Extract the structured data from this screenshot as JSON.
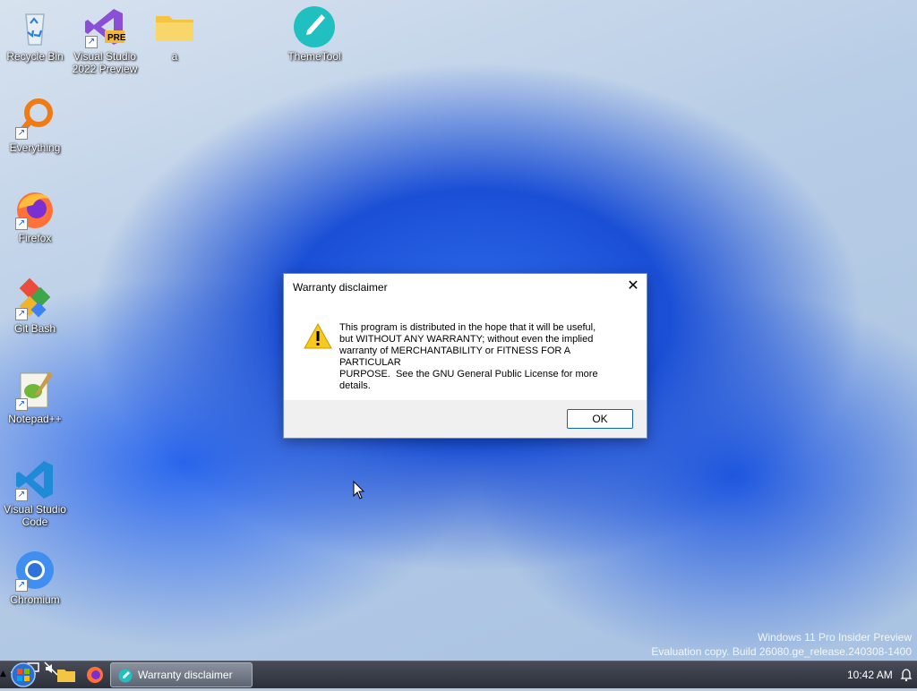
{
  "desktop": {
    "icons": [
      {
        "label": "Recycle Bin"
      },
      {
        "label": "Visual Studio 2022 Preview",
        "badge": "PRE"
      },
      {
        "label": "a"
      },
      {
        "label": "ThemeTool"
      },
      {
        "label": "Everything"
      },
      {
        "label": "Firefox"
      },
      {
        "label": "Git Bash"
      },
      {
        "label": "Notepad++"
      },
      {
        "label": "Visual Studio Code"
      },
      {
        "label": "Chromium"
      }
    ],
    "watermark": {
      "line1": "Windows 11 Pro Insider Preview",
      "line2": "Evaluation copy. Build 26080.ge_release.240308-1400"
    }
  },
  "dialog": {
    "title": "Warranty disclaimer",
    "close_glyph": "✕",
    "icon": "warning-icon",
    "message": "This program is distributed in the hope that it will be useful,\nbut WITHOUT ANY WARRANTY; without even the implied\nwarranty of MERCHANTABILITY or FITNESS FOR A PARTICULAR\nPURPOSE.  See the GNU General Public License for more\ndetails.",
    "ok_label": "OK"
  },
  "taskbar": {
    "active_task": "Warranty disclaimer",
    "clock": "10:42 AM",
    "tray_chevron": "▲"
  },
  "colors": {
    "accent": "#0a64c2",
    "taskbar": "#2d3039"
  }
}
